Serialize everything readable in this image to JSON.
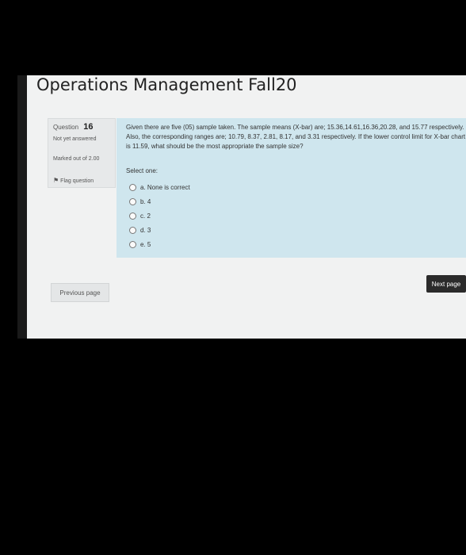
{
  "page": {
    "title": "Operations Management Fall20"
  },
  "question_info": {
    "label": "Question",
    "number": "16",
    "status": "Not yet answered",
    "marked": "Marked out of 2.00",
    "flag_label": "Flag question"
  },
  "question": {
    "text": "Given there are five (05) sample taken. The sample means (X-bar) are; 15.36,14.61,16.36,20.28, and 15.77 respectively. Also, the corresponding ranges are; 10.79, 8.37, 2.81, 8.17, and 3.31 respectively. If the lower control limit for X-bar chart is 11.59, what should be the most appropriate the sample size?",
    "select_one": "Select one:",
    "options": [
      "a. None is correct",
      "b. 4",
      "c. 2",
      "d. 3",
      "e. 5"
    ]
  },
  "nav": {
    "previous": "Previous page",
    "next": "Next page"
  }
}
